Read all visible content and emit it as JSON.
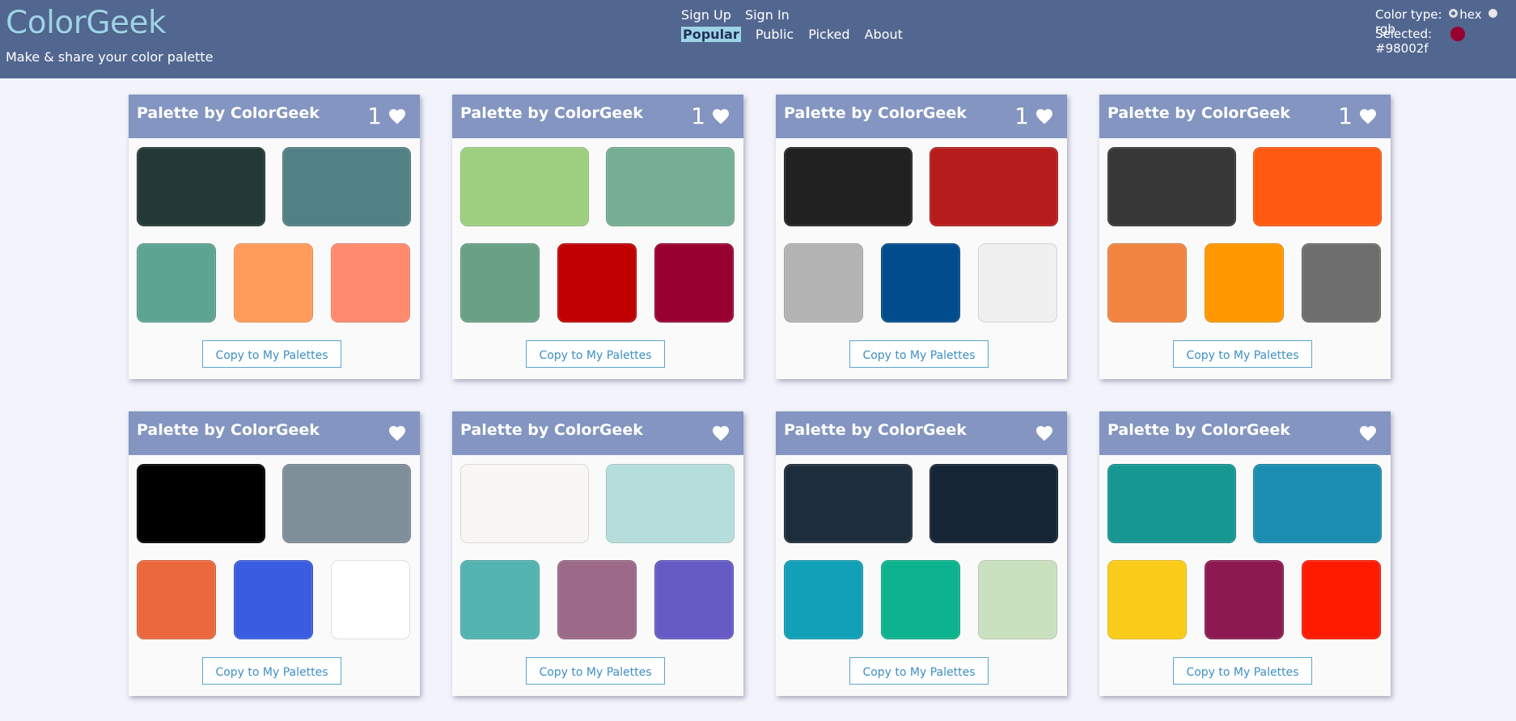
{
  "app": {
    "logo": "ColorGeek",
    "tagline": "Make & share your color palette"
  },
  "nav": {
    "signup": "Sign Up",
    "signin": "Sign In",
    "popular": "Popular",
    "public": "Public",
    "picked": "Picked",
    "about": "About"
  },
  "settings": {
    "color_type_label": "Color type:",
    "hex_label": "hex",
    "rgb_label": "rgb",
    "selected_type": "hex",
    "selected_label": "Selected:",
    "selected_value": "#98002f",
    "selected_color": "#98002f"
  },
  "palettes": [
    {
      "title": "Palette by ColorGeek",
      "likes": "1",
      "colors": [
        "#243937",
        "#528185",
        "#5ea493",
        "#ff9b5b",
        "#ff8a6c"
      ],
      "copy_label": "Copy to My Palettes"
    },
    {
      "title": "Palette by ColorGeek",
      "likes": "1",
      "colors": [
        "#9ecf7f",
        "#75ae95",
        "#69a086",
        "#c00000",
        "#98002f"
      ],
      "copy_label": "Copy to My Palettes"
    },
    {
      "title": "Palette by ColorGeek",
      "likes": "1",
      "colors": [
        "#212121",
        "#b71c1c",
        "#b3b3b3",
        "#004c8c",
        "#f0f0f0"
      ],
      "copy_label": "Copy to My Palettes"
    },
    {
      "title": "Palette by ColorGeek",
      "likes": "1",
      "colors": [
        "#373737",
        "#ff5a10",
        "#f1843f",
        "#ff9800",
        "#6e6e6e"
      ],
      "copy_label": "Copy to My Palettes"
    },
    {
      "title": "Palette by ColorGeek",
      "likes": "",
      "colors": [
        "#000000",
        "#7f8f99",
        "#ea683c",
        "#3a5ce0",
        "#ffffff"
      ],
      "copy_label": "Copy to My Palettes"
    },
    {
      "title": "Palette by ColorGeek",
      "likes": "",
      "colors": [
        "#f8f7f3",
        "#b5dddc",
        "#52b3b0",
        "#9c6988",
        "#665bc5"
      ],
      "copy_label": "Copy to My Palettes"
    },
    {
      "title": "Palette by ColorGeek",
      "likes": "",
      "colors": [
        "#1e2d3b",
        "#162536",
        "#11a0b7",
        "#0cb38e",
        "#cae1c0"
      ],
      "copy_label": "Copy to My Palettes"
    },
    {
      "title": "Palette by ColorGeek",
      "likes": "",
      "colors": [
        "#169792",
        "#1b8db0",
        "#facc19",
        "#8c1a50",
        "#ff1b00"
      ],
      "copy_label": "Copy to My Palettes"
    }
  ]
}
